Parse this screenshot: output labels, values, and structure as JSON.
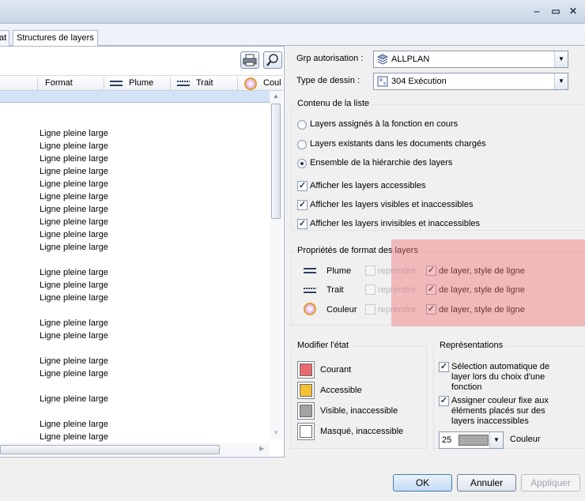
{
  "window": {
    "minimize": "‒",
    "maximize": "▭",
    "close": "✕"
  },
  "tabs": [
    "at",
    "Structures de layers"
  ],
  "list": {
    "columns": {
      "format": "Format",
      "plume": "Plume",
      "trait": "Trait",
      "couleur": "Coul"
    },
    "rows": [
      "Ligne pleine large",
      "Ligne pleine large",
      "Ligne pleine large",
      "Ligne pleine large",
      "Ligne pleine large",
      "Ligne pleine large",
      "Ligne pleine large",
      "Ligne pleine large",
      "Ligne pleine large",
      "Ligne pleine large",
      "Ligne pleine large",
      "Ligne pleine large",
      "Ligne pleine large",
      "Ligne pleine large",
      "Ligne pleine large",
      "Ligne pleine large",
      "Ligne pleine large",
      "Ligne pleine large",
      "Ligne pleine large",
      "Ligne pleine large"
    ]
  },
  "form": {
    "grp_label": "Grp autorisation :",
    "grp_value": "ALLPLAN",
    "type_label": "Type de dessin :",
    "type_value": "304 Exécution"
  },
  "contenu": {
    "title": "Contenu de la liste",
    "radio1": "Layers assignés à la fonction en cours",
    "radio2": "Layers existants dans les documents chargés",
    "radio3": "Ensemble de la hiérarchie des layers",
    "check1": "Afficher les layers accessibles",
    "check2": "Afficher les layers visibles et inaccessibles",
    "check3": "Afficher les layers invisibles et inaccessibles"
  },
  "proprietes": {
    "title": "Propriétés de format des layers",
    "rows": [
      {
        "name": "Plume",
        "reprendre": "reprendre",
        "delayer": "de layer, style de ligne"
      },
      {
        "name": "Trait",
        "reprendre": "reprendre",
        "delayer": "de layer, style de ligne"
      },
      {
        "name": "Couleur",
        "reprendre": "reprendre",
        "delayer": "de layer, style de ligne"
      }
    ]
  },
  "etat": {
    "title": "Modifier l'état",
    "items": [
      {
        "label": "Courant",
        "color": "#e86a70"
      },
      {
        "label": "Accessible",
        "color": "#f5c132"
      },
      {
        "label": "Visible, inaccessible",
        "color": "#a3a3a3"
      },
      {
        "label": "Masqué, inaccessible",
        "color": "#ffffff"
      }
    ]
  },
  "representations": {
    "title": "Représentations",
    "check1_l1": "Sélection automatique de",
    "check1_l2": "layer lors du choix d'une",
    "check1_l3": "fonction",
    "check2_l1": "Assigner couleur fixe aux",
    "check2_l2": "éléments placés sur des",
    "check2_l3": "layers inaccessibles",
    "color_number": "25",
    "color_label": "Couleur"
  },
  "buttons": {
    "ok": "OK",
    "annuler": "Annuler",
    "appliquer": "Appliquer"
  }
}
